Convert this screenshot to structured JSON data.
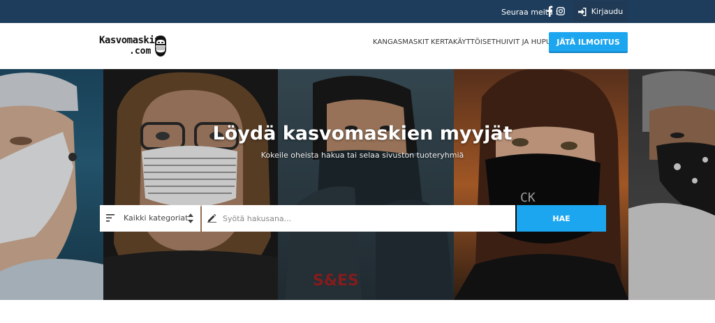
{
  "topbar": {
    "follow_label": "Seuraa meitä :",
    "social": [
      {
        "name": "facebook-icon"
      },
      {
        "name": "instagram-icon"
      }
    ],
    "login_label": "Kirjaudu",
    "bg_color": "#1e3d5c"
  },
  "header": {
    "logo_line1": "Kasvomaskit",
    "logo_line2": ".com",
    "nav": [
      "KANGASMASKIT",
      "KERTAKÄYTTÖISET",
      "HUIVIT JA HUPUT"
    ],
    "cta_label": "JÄTÄ ILMOITUS",
    "accent_color": "#1ca6ef"
  },
  "hero": {
    "title": "Löydä kasvomaskien myyjät",
    "subtitle": "Kokeile oheista hakua tai selaa sivuston tuoteryhmiä",
    "category_selected": "Kaikki kategoriat",
    "search_placeholder": "Syötä hakusana...",
    "search_button": "HAE"
  }
}
